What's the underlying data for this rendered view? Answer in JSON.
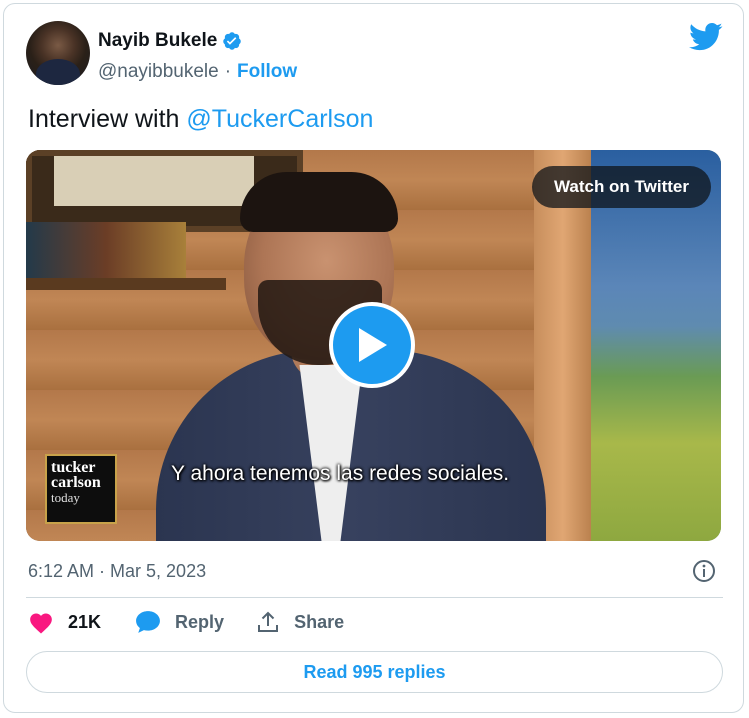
{
  "author": {
    "name": "Nayib Bukele",
    "handle": "@nayibbukele",
    "separator": "·",
    "follow_label": "Follow",
    "verified_icon": "verified-badge-icon"
  },
  "tweet": {
    "text_prefix": "Interview with",
    "mention": "@TuckerCarlson"
  },
  "media": {
    "watch_label": "Watch on Twitter",
    "caption": "Y ahora tenemos las redes sociales.",
    "logo_line1": "tucker",
    "logo_line2": "carlson",
    "logo_line3": "today",
    "play_icon": "play-icon"
  },
  "meta": {
    "timestamp": "6:12 AM · Mar 5, 2023",
    "info_icon": "info-icon"
  },
  "actions": {
    "like_count": "21K",
    "reply_label": "Reply",
    "share_label": "Share"
  },
  "footer": {
    "read_replies_label": "Read 995 replies"
  },
  "colors": {
    "accent": "#1d9bf0",
    "like": "#f91880",
    "text": "#0f1419",
    "muted": "#536471",
    "border": "#cfd9de"
  }
}
